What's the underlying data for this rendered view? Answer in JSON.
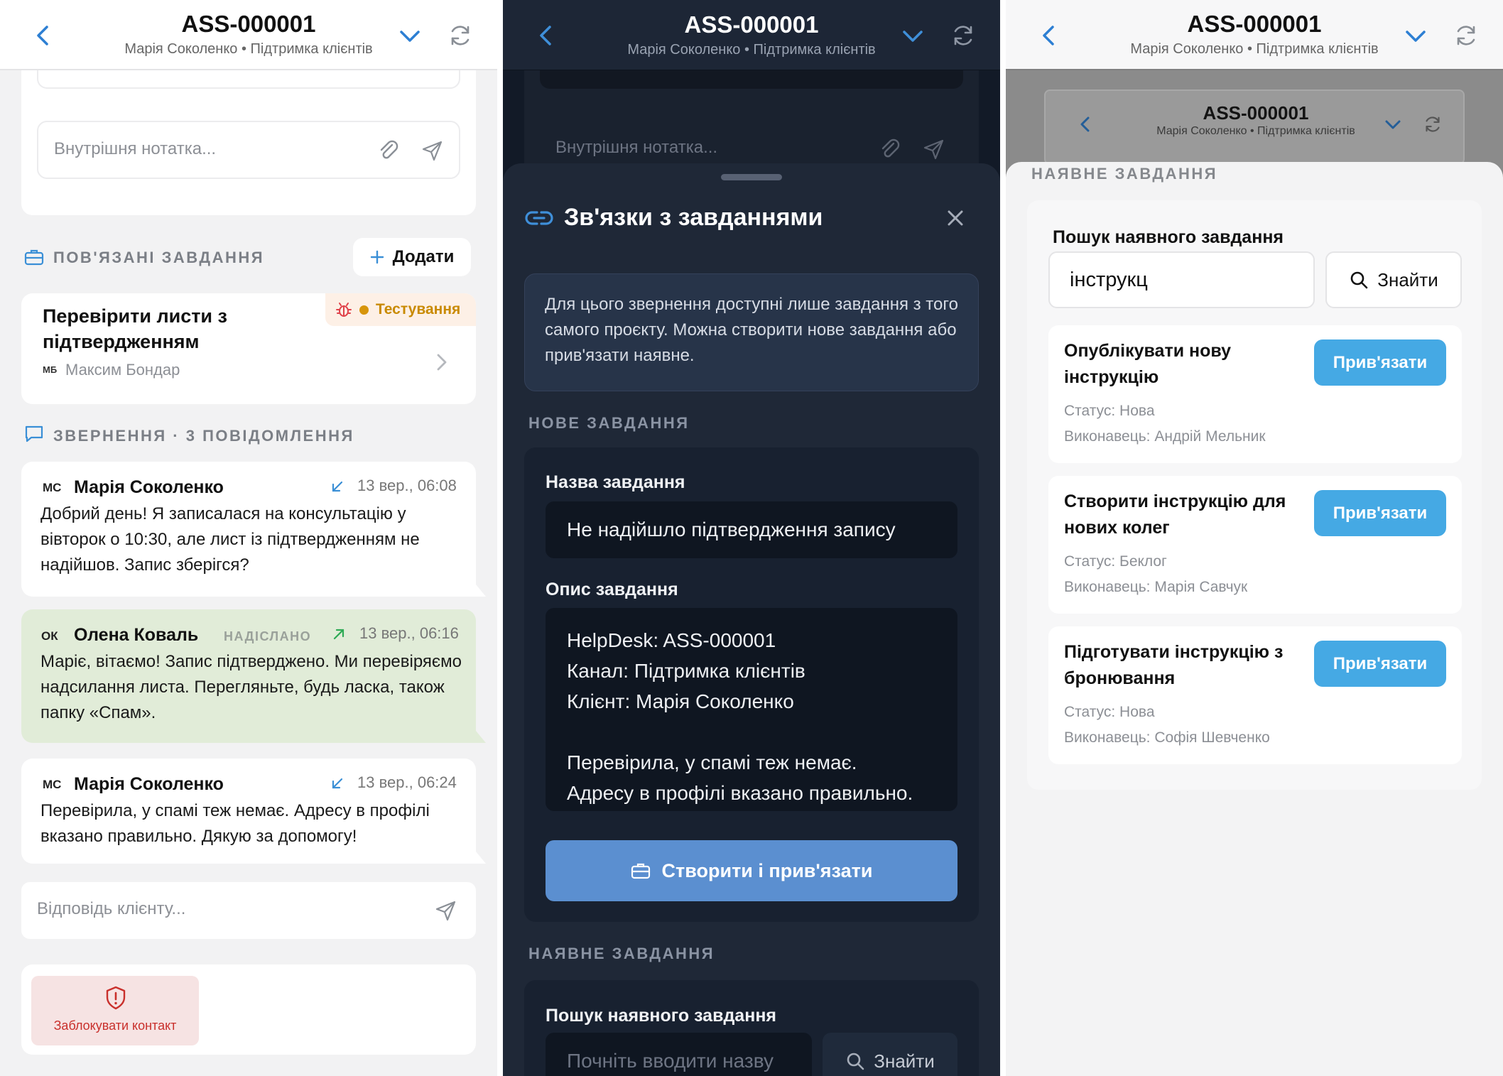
{
  "header": {
    "title": "ASS-000001",
    "subtitle": "Марія Соколенко • Підтримка клієнтів"
  },
  "panel1": {
    "note_placeholder": "Внутрішня нотатка...",
    "linked_section": "ПОВ'ЯЗАНІ ЗАВДАННЯ",
    "add_label": "Додати",
    "task": {
      "title": "Перевірити листи з підтвердженням",
      "status": "Тестування",
      "assignee_initials": "МБ",
      "assignee": "Максим Бондар"
    },
    "messages_section": "ЗВЕРНЕННЯ · 3 ПОВІДОМЛЕННЯ",
    "messages": [
      {
        "initials": "МС",
        "author": "Марія Соколенко",
        "time": "13 вер., 06:08",
        "text": "Добрий день! Я записалася на консультацію у вівторок о 10:30, але лист із підтвердженням не надійшов. Запис зберігся?"
      },
      {
        "initials": "ОК",
        "author": "Олена Коваль",
        "sent_label": "НАДІСЛАНО",
        "time": "13 вер., 06:16",
        "text": "Маріє, вітаємо! Запис підтверджено. Ми перевіряємо надсилання листа. Перегляньте, будь ласка, також папку «Спам»."
      },
      {
        "initials": "МС",
        "author": "Марія Соколенко",
        "time": "13 вер., 06:24",
        "text": "Перевірила, у спамі теж немає. Адресу в профілі вказано правильно. Дякую за допомогу!"
      }
    ],
    "reply_placeholder": "Відповідь клієнту...",
    "block_label": "Заблокувати контакт"
  },
  "panel2": {
    "bg_note_placeholder": "Внутрішня нотатка...",
    "sheet_title": "Зв'язки з завданнями",
    "info_text": "Для цього звернення доступні лише завдання з того самого проєкту. Можна створити нове завдання або прив'язати наявне.",
    "new_section": "НОВЕ ЗАВДАННЯ",
    "name_label": "Назва завдання",
    "name_value": "Не надійшло підтвердження запису",
    "desc_label": "Опис завдання",
    "desc_lines": [
      "HelpDesk: ASS-000001",
      "Канал: Підтримка клієнтів",
      "Клієнт: Марія Соколенко",
      "",
      "Перевірила, у спамі теж немає.",
      "Адресу в профілі вказано правильно."
    ],
    "create_label": "Створити і прив'язати",
    "existing_section": "НАЯВНЕ ЗАВДАННЯ",
    "search_label": "Пошук наявного завдання",
    "search_placeholder": "Почніть вводити назву",
    "find_label": "Знайти"
  },
  "panel3": {
    "existing_section": "НАЯВНЕ ЗАВДАННЯ",
    "search_label": "Пошук наявного завдання",
    "search_value": "інструкц",
    "find_label": "Знайти",
    "bind_label": "Прив'язати",
    "results": [
      {
        "title": "Опублікувати нову інструкцію",
        "status": "Статус: Нова",
        "assignee": "Виконавець: Андрій Мельник"
      },
      {
        "title": "Створити інструкцію для нових колег",
        "status": "Статус: Беклог",
        "assignee": "Виконавець: Марія Савчук"
      },
      {
        "title": "Підготувати інструкцію з бронювання",
        "status": "Статус: Нова",
        "assignee": "Виконавець: Софія Шевченко"
      }
    ]
  },
  "colors": {
    "accent": "#3a8fd6",
    "bind_button": "#45a9e4",
    "status_testing": "#c98a00",
    "sent_bg": "#e1ecd8",
    "block_red": "#c9302c",
    "create_button": "#5b8fd0"
  },
  "icons": [
    "back-chevron-icon",
    "chevron-down-icon",
    "sync-icon",
    "paperclip-icon",
    "send-icon",
    "briefcase-icon",
    "plus-icon",
    "bug-icon",
    "chevron-right-icon",
    "chat-icon",
    "incoming-arrow-icon",
    "outgoing-arrow-icon",
    "shield-alert-icon",
    "link-icon",
    "close-icon",
    "search-icon"
  ]
}
